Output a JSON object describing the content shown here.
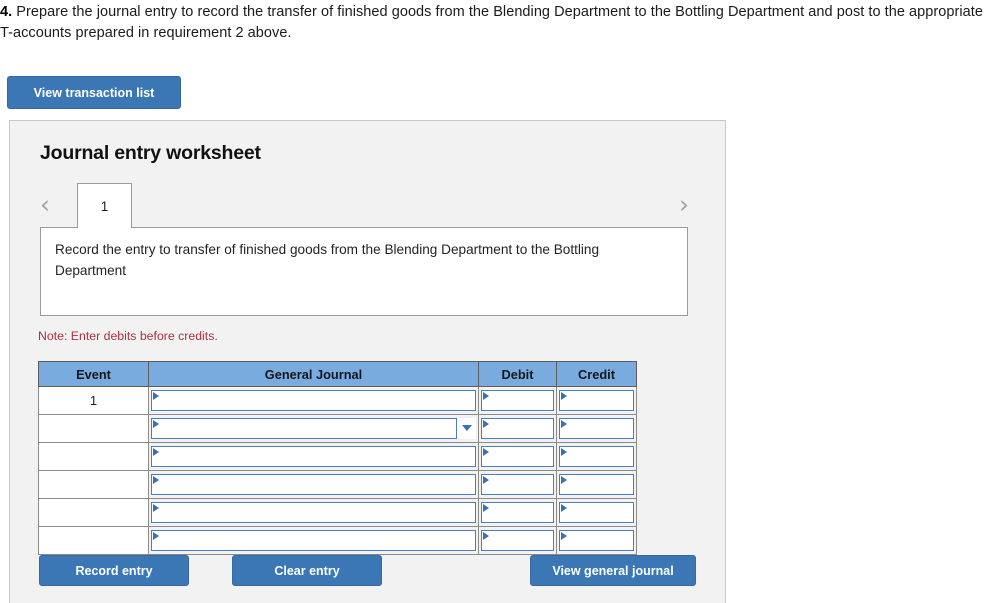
{
  "prompt": {
    "number": "4.",
    "text": "Prepare the journal entry to record the transfer of finished goods from the Blending Department to the Bottling Department and post to the appropriate T-accounts prepared in requirement 2 above."
  },
  "toolbar": {
    "view_transaction_list_label": "View transaction list"
  },
  "worksheet": {
    "title": "Journal entry worksheet",
    "pager": {
      "prev_icon": "chevron-left-icon",
      "next_icon": "chevron-right-icon",
      "prev_glyph": "‹",
      "next_glyph": "›",
      "tabs": [
        "1"
      ],
      "active_tab": "1"
    },
    "instruction": "Record the entry to transfer of finished goods from the Blending Department to the Bottling Department",
    "note": "Note: Enter debits before credits.",
    "note_color": "#b03040",
    "table": {
      "headers": [
        "Event",
        "General Journal",
        "Debit",
        "Credit"
      ],
      "rows": [
        {
          "event": "1",
          "journal": "",
          "debit": "",
          "credit": "",
          "has_dropdown": false
        },
        {
          "event": "",
          "journal": "",
          "debit": "",
          "credit": "",
          "has_dropdown": true
        },
        {
          "event": "",
          "journal": "",
          "debit": "",
          "credit": "",
          "has_dropdown": false
        },
        {
          "event": "",
          "journal": "",
          "debit": "",
          "credit": "",
          "has_dropdown": false
        },
        {
          "event": "",
          "journal": "",
          "debit": "",
          "credit": "",
          "has_dropdown": false
        },
        {
          "event": "",
          "journal": "",
          "debit": "",
          "credit": "",
          "has_dropdown": false
        }
      ]
    },
    "footer": {
      "record_entry_label": "Record entry",
      "clear_entry_label": "Clear entry",
      "view_general_journal_label": "View general journal"
    }
  },
  "colors": {
    "button_blue": "#3c77b5",
    "header_blue": "#7aabdf",
    "panel_bg": "#f2f2f2",
    "field_border_blue": "#4a7fbf"
  }
}
